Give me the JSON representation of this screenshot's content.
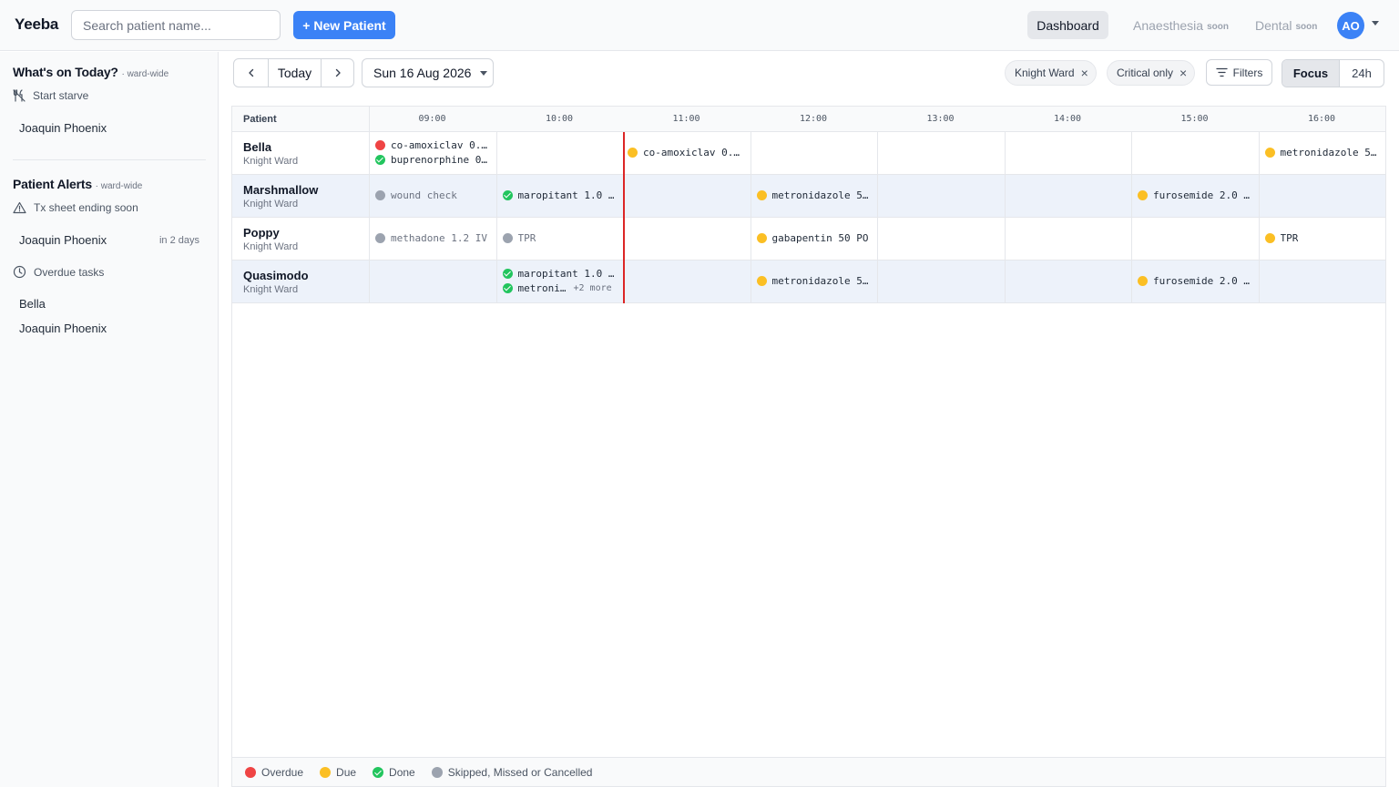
{
  "app": {
    "brand": "Yeeba",
    "search_placeholder": "Search patient name...",
    "new_patient_label": "+ New Patient",
    "nav": {
      "dashboard": "Dashboard",
      "anaesthesia": "Anaesthesia",
      "dental": "Dental",
      "soon": "soon"
    },
    "avatar_initials": "AO"
  },
  "sidebar": {
    "today": {
      "title": "What's on Today?",
      "scope": "· ward-wide",
      "group_label": "Start starve",
      "group_icon": "fork-knife-off-icon",
      "patients": [
        "Joaquin Phoenix"
      ]
    },
    "alerts": {
      "title": "Patient Alerts",
      "scope": "· ward-wide",
      "tx_ending": {
        "label": "Tx sheet ending soon",
        "icon": "warning-triangle-icon",
        "items": [
          {
            "name": "Joaquin Phoenix",
            "meta": "in 2 days"
          }
        ]
      },
      "overdue": {
        "label": "Overdue tasks",
        "icon": "clock-icon",
        "items": [
          "Bella",
          "Joaquin Phoenix"
        ]
      }
    }
  },
  "toolbar": {
    "today_label": "Today",
    "date_label": "Sun 16 Aug 2026",
    "chips": [
      "Knight Ward",
      "Critical only"
    ],
    "filters_label": "Filters",
    "view_options": [
      "Focus",
      "24h"
    ],
    "view_selected": "Focus"
  },
  "grid": {
    "patient_header": "Patient",
    "hours": [
      "09:00",
      "10:00",
      "11:00",
      "12:00",
      "13:00",
      "14:00",
      "15:00",
      "16:00"
    ],
    "rows": [
      {
        "name": "Bella",
        "ward": "Knight Ward",
        "tasks": [
          {
            "hour": 0,
            "line": 0,
            "status": "overdue",
            "text": "co-amoxiclav 0.…"
          },
          {
            "hour": 0,
            "line": 1,
            "status": "done",
            "text": "buprenorphine 0…"
          },
          {
            "hour": 2,
            "line": -1,
            "status": "due",
            "text": "co-amoxiclav 0.…",
            "offset": "half"
          },
          {
            "hour": 7,
            "line": -1,
            "status": "due",
            "text": "metronidazole 5…"
          }
        ]
      },
      {
        "name": "Marshmallow",
        "ward": "Knight Ward",
        "tasks": [
          {
            "hour": 0,
            "line": -1,
            "status": "skipped",
            "text": "wound check"
          },
          {
            "hour": 1,
            "line": -1,
            "status": "done",
            "text": "maropitant 1.0 …"
          },
          {
            "hour": 3,
            "line": -1,
            "status": "due",
            "text": "metronidazole 5…"
          },
          {
            "hour": 6,
            "line": -1,
            "status": "due",
            "text": "furosemide 2.0 …"
          }
        ]
      },
      {
        "name": "Poppy",
        "ward": "Knight Ward",
        "tasks": [
          {
            "hour": 0,
            "line": -1,
            "status": "skipped",
            "text": "methadone 1.2 IV"
          },
          {
            "hour": 1,
            "line": -1,
            "status": "skipped",
            "text": "TPR"
          },
          {
            "hour": 3,
            "line": -1,
            "status": "due",
            "text": "gabapentin 50 PO"
          },
          {
            "hour": 7,
            "line": -1,
            "status": "due",
            "text": "TPR"
          }
        ]
      },
      {
        "name": "Quasimodo",
        "ward": "Knight Ward",
        "tasks": [
          {
            "hour": 1,
            "line": 0,
            "status": "done",
            "text": "maropitant 1.0 …"
          },
          {
            "hour": 1,
            "line": 1,
            "status": "done",
            "text": "metroni…",
            "more": "+2 more"
          },
          {
            "hour": 3,
            "line": -1,
            "status": "due",
            "text": "metronidazole 5…"
          },
          {
            "hour": 6,
            "line": -1,
            "status": "due",
            "text": "furosemide 2.0 …"
          }
        ]
      }
    ],
    "now_time": "10:30"
  },
  "legend": [
    {
      "status": "overdue",
      "label": "Overdue"
    },
    {
      "status": "due",
      "label": "Due"
    },
    {
      "status": "done",
      "label": "Done"
    },
    {
      "status": "skipped",
      "label": "Skipped, Missed or Cancelled"
    }
  ],
  "colors": {
    "overdue": "#ef4444",
    "due": "#fbbf24",
    "done": "#22c55e",
    "skipped": "#9ca3af",
    "accent": "#3b82f6",
    "now_line": "#dc2626"
  }
}
